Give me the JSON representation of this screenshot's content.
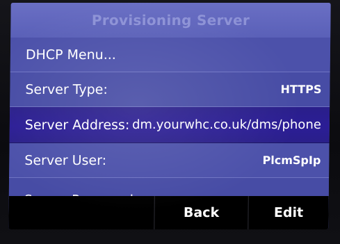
{
  "title": "Provisioning Server",
  "rows": [
    {
      "label": "DHCP Menu...",
      "value": ""
    },
    {
      "label": "Server Type:",
      "value": "HTTPS"
    },
    {
      "label": "Server Address:",
      "value": "dm.yourwhc.co.uk/dms/phone"
    },
    {
      "label": "Server User:",
      "value": "PlcmSpIp"
    },
    {
      "label": "Server Password:",
      "value": "****"
    }
  ],
  "softkeys": {
    "back": "Back",
    "edit": "Edit"
  },
  "colors": {
    "screen_bg": "#4a4fa8",
    "title_bg": "#5a60b8",
    "selected_row": "#2b1d96",
    "softkey_bar": "#000000"
  }
}
